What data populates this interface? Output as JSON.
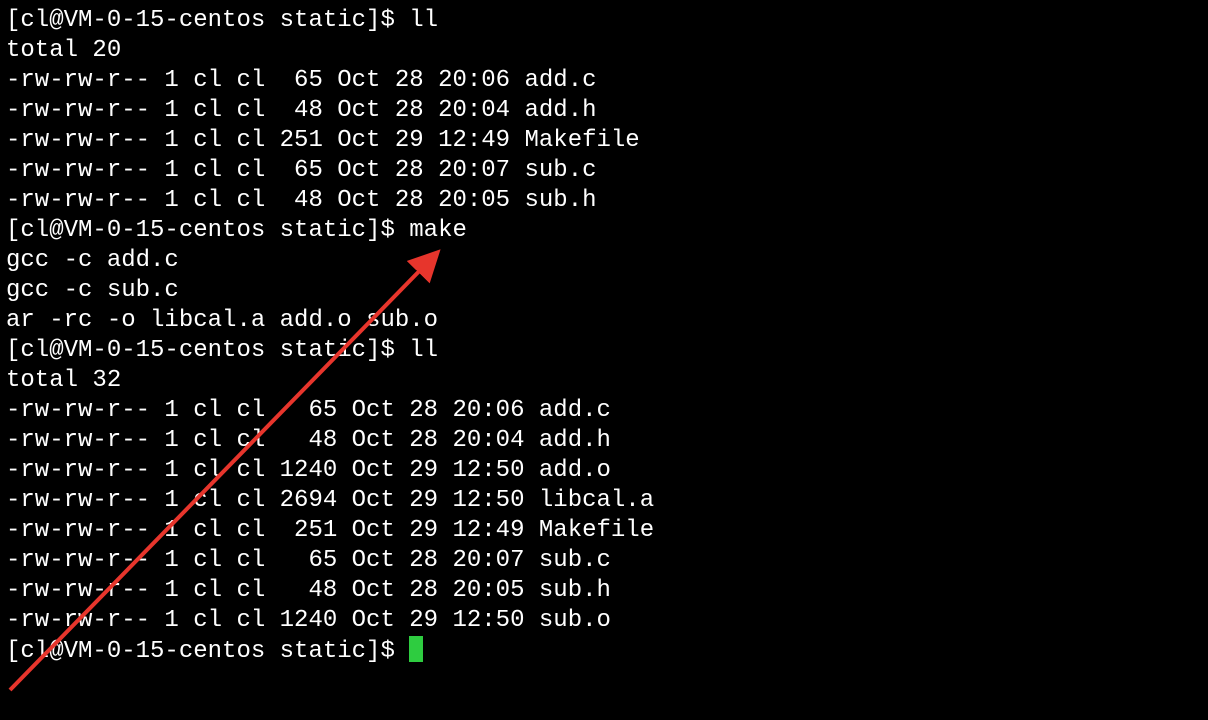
{
  "prompt": {
    "user": "cl",
    "host": "VM-0-15-centos",
    "dir": "static",
    "suffix": "$"
  },
  "commands": {
    "ll1": "ll",
    "make": "make",
    "ll2": "ll"
  },
  "ll1_total": "total 20",
  "ll1_files": [
    {
      "perm": "-rw-rw-r--",
      "links": "1",
      "owner": "cl",
      "group": "cl",
      "size": "65",
      "date": "Oct 28 20:06",
      "name": "add.c"
    },
    {
      "perm": "-rw-rw-r--",
      "links": "1",
      "owner": "cl",
      "group": "cl",
      "size": "48",
      "date": "Oct 28 20:04",
      "name": "add.h"
    },
    {
      "perm": "-rw-rw-r--",
      "links": "1",
      "owner": "cl",
      "group": "cl",
      "size": "251",
      "date": "Oct 29 12:49",
      "name": "Makefile"
    },
    {
      "perm": "-rw-rw-r--",
      "links": "1",
      "owner": "cl",
      "group": "cl",
      "size": "65",
      "date": "Oct 28 20:07",
      "name": "sub.c"
    },
    {
      "perm": "-rw-rw-r--",
      "links": "1",
      "owner": "cl",
      "group": "cl",
      "size": "48",
      "date": "Oct 28 20:05",
      "name": "sub.h"
    }
  ],
  "make_output": [
    "gcc -c add.c",
    "gcc -c sub.c",
    "ar -rc -o libcal.a add.o sub.o"
  ],
  "ll2_total": "total 32",
  "ll2_files": [
    {
      "perm": "-rw-rw-r--",
      "links": "1",
      "owner": "cl",
      "group": "cl",
      "size": "65",
      "date": "Oct 28 20:06",
      "name": "add.c"
    },
    {
      "perm": "-rw-rw-r--",
      "links": "1",
      "owner": "cl",
      "group": "cl",
      "size": "48",
      "date": "Oct 28 20:04",
      "name": "add.h"
    },
    {
      "perm": "-rw-rw-r--",
      "links": "1",
      "owner": "cl",
      "group": "cl",
      "size": "1240",
      "date": "Oct 29 12:50",
      "name": "add.o"
    },
    {
      "perm": "-rw-rw-r--",
      "links": "1",
      "owner": "cl",
      "group": "cl",
      "size": "2694",
      "date": "Oct 29 12:50",
      "name": "libcal.a"
    },
    {
      "perm": "-rw-rw-r--",
      "links": "1",
      "owner": "cl",
      "group": "cl",
      "size": "251",
      "date": "Oct 29 12:49",
      "name": "Makefile"
    },
    {
      "perm": "-rw-rw-r--",
      "links": "1",
      "owner": "cl",
      "group": "cl",
      "size": "65",
      "date": "Oct 28 20:07",
      "name": "sub.c"
    },
    {
      "perm": "-rw-rw-r--",
      "links": "1",
      "owner": "cl",
      "group": "cl",
      "size": "48",
      "date": "Oct 28 20:05",
      "name": "sub.h"
    },
    {
      "perm": "-rw-rw-r--",
      "links": "1",
      "owner": "cl",
      "group": "cl",
      "size": "1240",
      "date": "Oct 29 12:50",
      "name": "sub.o"
    }
  ],
  "annotation": {
    "arrow_color": "#e7352c"
  },
  "cursor_color": "#2ecc40"
}
